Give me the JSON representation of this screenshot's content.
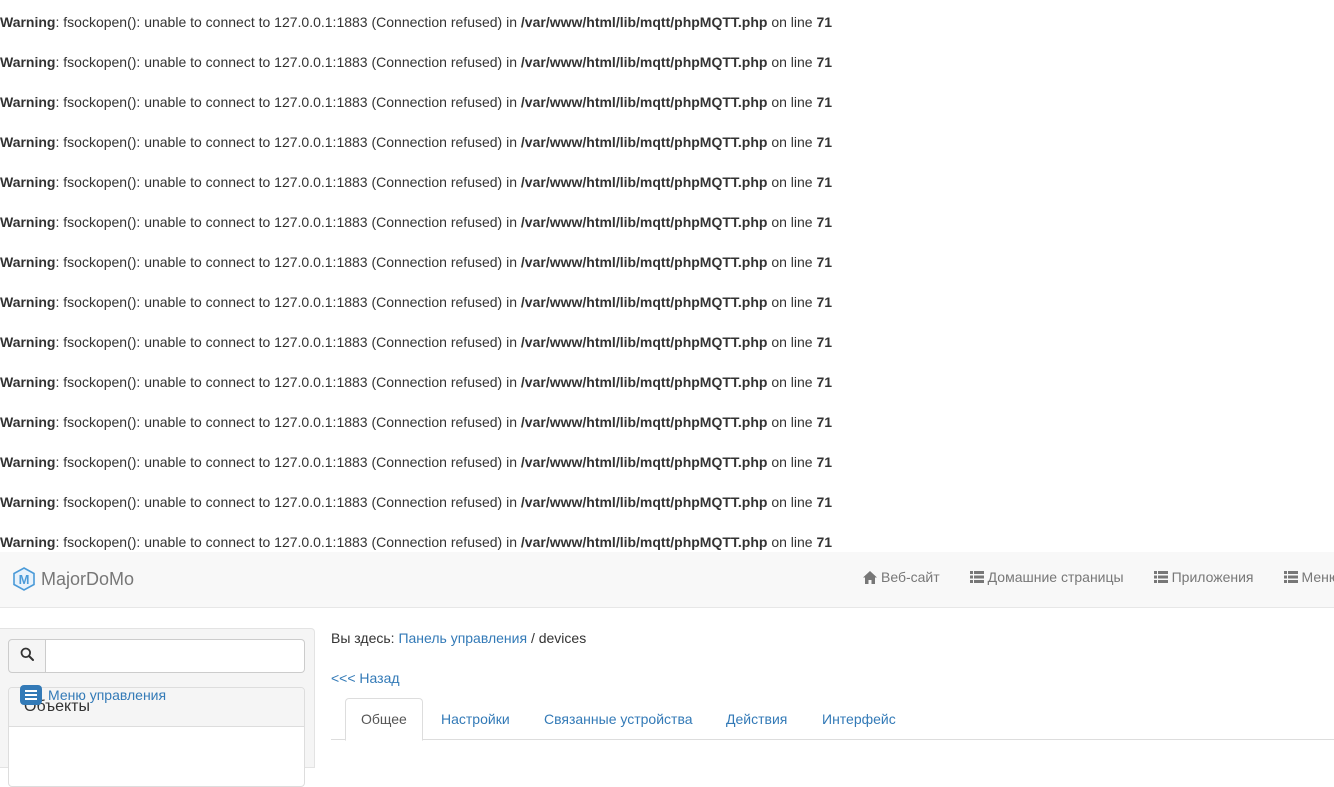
{
  "warnings": {
    "label": "Warning",
    "message": ": fsockopen(): unable to connect to 127.0.0.1:1883 (Connection refused) in ",
    "file": "/var/www/html/lib/mqtt/phpMQTT.php",
    "on_line": " on line ",
    "line_number": "71",
    "count": 14
  },
  "navbar": {
    "brand": "MajorDoMo",
    "items": [
      {
        "label": "Веб-сайт",
        "icon": "home-icon"
      },
      {
        "label": "Домашние страницы",
        "icon": "list-icon"
      },
      {
        "label": "Приложения",
        "icon": "list-icon"
      },
      {
        "label": "Меню",
        "icon": "list-icon"
      }
    ]
  },
  "sidebar": {
    "search": {
      "placeholder": "",
      "value": "",
      "icon": "search-icon"
    },
    "panel_title": "Объекты",
    "menu_link": "Меню управления"
  },
  "main": {
    "breadcrumb": {
      "prefix": "Вы здесь: ",
      "link": "Панель управления",
      "separator": " / ",
      "current": "devices"
    },
    "back_link": "<<< Назад",
    "tabs": [
      {
        "label": "Общее",
        "active": true
      },
      {
        "label": "Настройки",
        "active": false
      },
      {
        "label": "Связанные устройства",
        "active": false
      },
      {
        "label": "Действия",
        "active": false
      },
      {
        "label": "Интерфейс",
        "active": false
      }
    ]
  },
  "colors": {
    "link": "#337ab7",
    "navbar_bg": "#f8f8f8",
    "text": "#333333"
  }
}
